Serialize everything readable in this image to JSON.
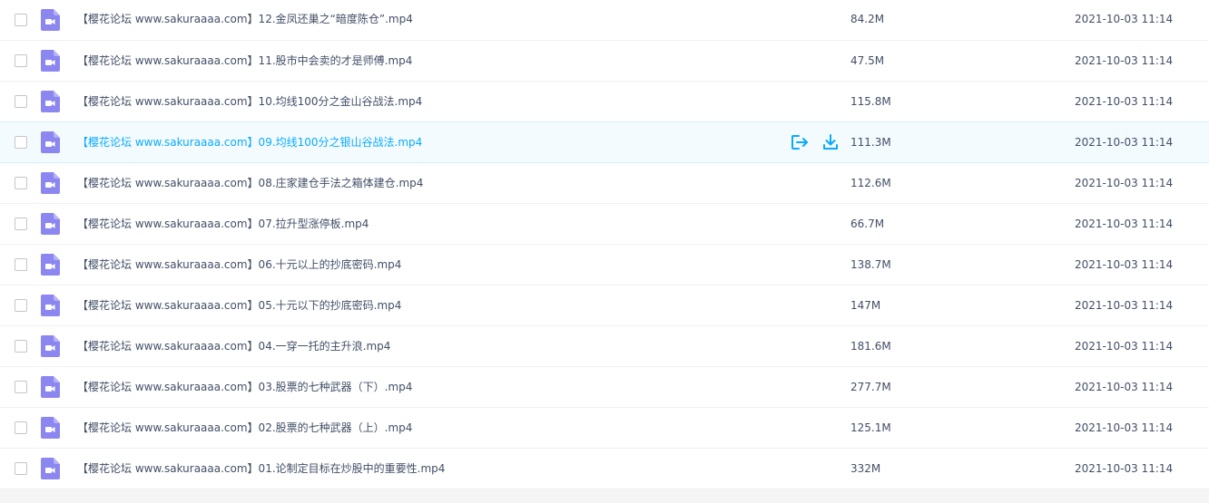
{
  "files": [
    {
      "name": "【樱花论坛 www.sakuraaaa.com】12.金凤还巢之“暗度陈仓”.mp4",
      "size": "84.2M",
      "date": "2021-10-03 11:14"
    },
    {
      "name": "【樱花论坛 www.sakuraaaa.com】11.股市中会卖的才是师傅.mp4",
      "size": "47.5M",
      "date": "2021-10-03 11:14"
    },
    {
      "name": "【樱花论坛 www.sakuraaaa.com】10.均线100分之金山谷战法.mp4",
      "size": "115.8M",
      "date": "2021-10-03 11:14"
    },
    {
      "name": "【樱花论坛 www.sakuraaaa.com】09.均线100分之银山谷战法.mp4",
      "size": "111.3M",
      "date": "2021-10-03 11:14"
    },
    {
      "name": "【樱花论坛 www.sakuraaaa.com】08.庄家建仓手法之箱体建仓.mp4",
      "size": "112.6M",
      "date": "2021-10-03 11:14"
    },
    {
      "name": "【樱花论坛 www.sakuraaaa.com】07.拉升型涨停板.mp4",
      "size": "66.7M",
      "date": "2021-10-03 11:14"
    },
    {
      "name": "【樱花论坛 www.sakuraaaa.com】06.十元以上的抄底密码.mp4",
      "size": "138.7M",
      "date": "2021-10-03 11:14"
    },
    {
      "name": "【樱花论坛 www.sakuraaaa.com】05.十元以下的抄底密码.mp4",
      "size": "147M",
      "date": "2021-10-03 11:14"
    },
    {
      "name": "【樱花论坛 www.sakuraaaa.com】04.一穿一托的主升浪.mp4",
      "size": "181.6M",
      "date": "2021-10-03 11:14"
    },
    {
      "name": "【樱花论坛 www.sakuraaaa.com】03.股票的七种武器（下）.mp4",
      "size": "277.7M",
      "date": "2021-10-03 11:14"
    },
    {
      "name": "【樱花论坛 www.sakuraaaa.com】02.股票的七种武器（上）.mp4",
      "size": "125.1M",
      "date": "2021-10-03 11:14"
    },
    {
      "name": "【樱花论坛 www.sakuraaaa.com】01.论制定目标在炒股中的重要性.mp4",
      "size": "332M",
      "date": "2021-10-03 11:14"
    }
  ],
  "icons": {
    "file_icon": "video-file-icon",
    "share_icon": "share-icon",
    "download_icon": "download-icon"
  },
  "colors": {
    "file_icon": "#8b86f0",
    "highlight_text": "#09aaff",
    "action_icon": "#09aaff",
    "row_highlight_bg": "#f4fbff"
  }
}
